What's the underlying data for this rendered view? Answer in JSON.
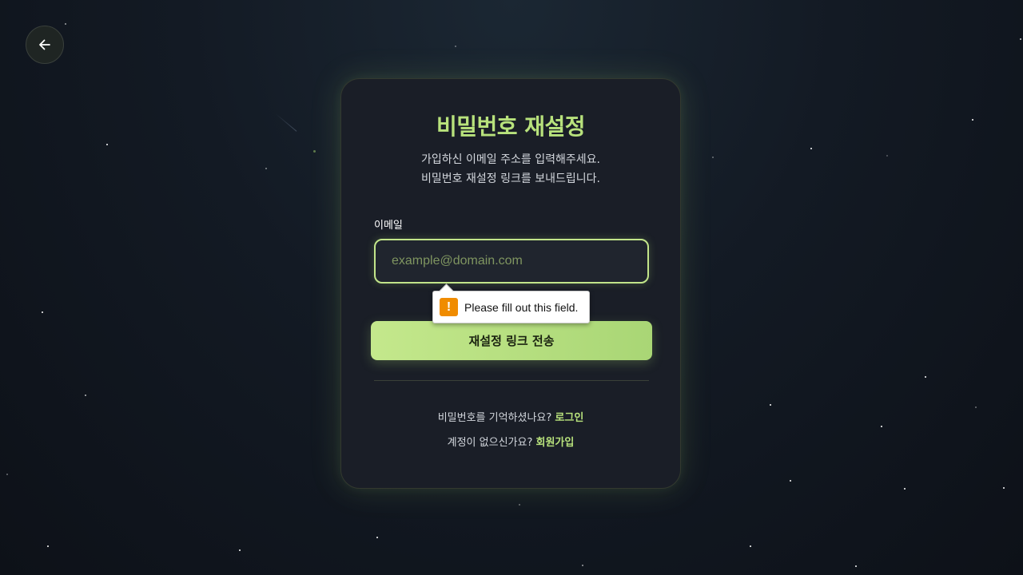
{
  "back_button": {
    "icon": "arrow-left-icon"
  },
  "card": {
    "title": "비밀번호 재설정",
    "subtitle_line1": "가입하신 이메일 주소를 입력해주세요.",
    "subtitle_line2": "비밀번호 재설정 링크를 보내드립니다.",
    "email_label": "이메일",
    "email_placeholder": "example@domain.com",
    "email_value": "",
    "submit_label": "재설정 링크 전송",
    "footer": {
      "remember_text": "비밀번호를 기억하셨나요?",
      "login_link": "로그인",
      "no_account_text": "계정이 없으신가요?",
      "signup_link": "회원가입"
    }
  },
  "validation_tooltip": {
    "icon": "warning-icon",
    "text": "Please fill out this field."
  },
  "colors": {
    "accent": "#b8e27c",
    "button_start": "#c4e88c",
    "button_end": "#a9d675",
    "card_bg": "#1a1e27",
    "warning": "#f08c00"
  }
}
